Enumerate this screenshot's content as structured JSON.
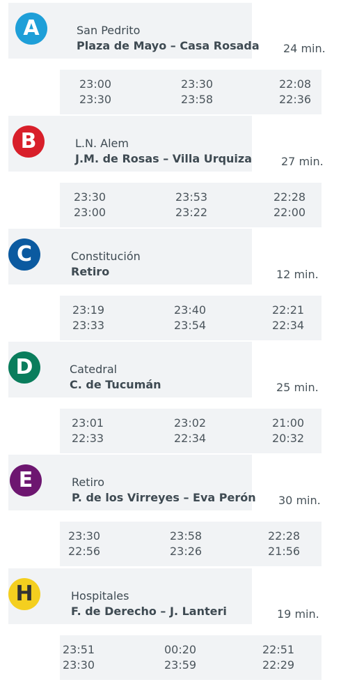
{
  "lines": [
    {
      "letter": "A",
      "color": "#1e9fd8",
      "origin": "San Pedrito",
      "destination": "Plaza de Mayo – Casa Rosada",
      "duration": "24 min.",
      "times": [
        [
          "23:00",
          "23:30"
        ],
        [
          "23:30",
          "23:58"
        ],
        [
          "22:08",
          "22:36"
        ]
      ]
    },
    {
      "letter": "B",
      "color": "#d81f2a",
      "origin": "L.N. Alem",
      "destination": "J.M. de Rosas – Villa Urquiza",
      "duration": "27 min.",
      "times": [
        [
          "23:30",
          "23:00"
        ],
        [
          "23:53",
          "23:22"
        ],
        [
          "22:28",
          "22:00"
        ]
      ]
    },
    {
      "letter": "C",
      "color": "#0b5aa0",
      "origin": "Constitución",
      "destination": "Retiro",
      "duration": "12 min.",
      "times": [
        [
          "23:19",
          "23:33"
        ],
        [
          "23:40",
          "23:54"
        ],
        [
          "22:21",
          "22:34"
        ]
      ]
    },
    {
      "letter": "D",
      "color": "#0a7d5c",
      "origin": "Catedral",
      "destination": "C. de Tucumán",
      "duration": "25 min.",
      "times": [
        [
          "23:01",
          "22:33"
        ],
        [
          "23:02",
          "22:34"
        ],
        [
          "21:00",
          "20:32"
        ]
      ]
    },
    {
      "letter": "E",
      "color": "#6d1670",
      "origin": "Retiro",
      "destination": "P. de los Virreyes – Eva Perón",
      "duration": "30 min.",
      "times": [
        [
          "23:30",
          "22:56"
        ],
        [
          "23:58",
          "23:26"
        ],
        [
          "22:28",
          "21:56"
        ]
      ]
    },
    {
      "letter": "H",
      "color": "#f4cf1f",
      "origin": "Hospitales",
      "destination": "F. de Derecho – J. Lanteri",
      "duration": "19 min.",
      "times": [
        [
          "23:51",
          "23:30"
        ],
        [
          "00:20",
          "23:59"
        ],
        [
          "22:51",
          "22:29"
        ]
      ]
    }
  ]
}
